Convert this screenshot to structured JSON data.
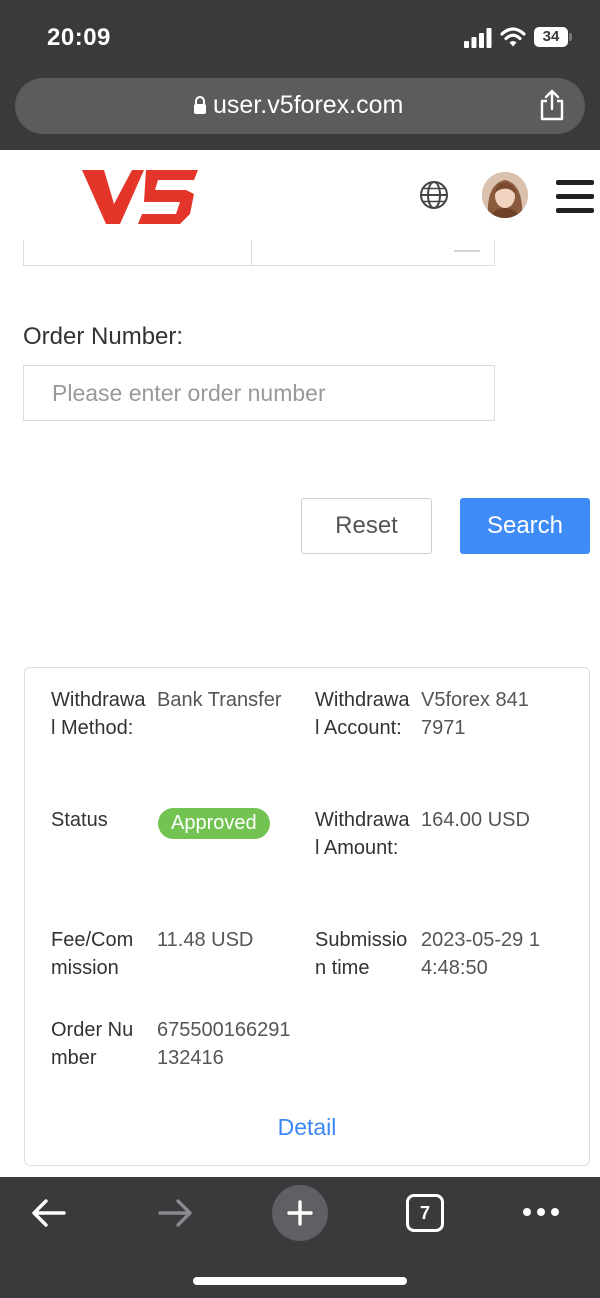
{
  "status_bar": {
    "time": "20:09",
    "battery": "34",
    "icons": [
      "signal-icon",
      "wifi-icon",
      "battery-icon"
    ]
  },
  "browser": {
    "url": "user.v5forex.com",
    "open_tabs": "7",
    "toolbar_icons": [
      "back-icon",
      "forward-icon",
      "plus-icon",
      "tabs-icon",
      "more-icon"
    ]
  },
  "header": {
    "logo_text": "V5",
    "brand_color": "#e3352a",
    "icons": [
      "globe-icon",
      "avatar",
      "menu-icon"
    ]
  },
  "form": {
    "order_label": "Order Number:",
    "order_placeholder": "Please enter order number",
    "order_value": "",
    "reset_label": "Reset",
    "search_label": "Search",
    "search_color": "#3f8cf8"
  },
  "record": {
    "withdrawal_method_label": "Withdrawal Method:",
    "withdrawal_method_value": "Bank Transfer",
    "withdrawal_account_label": "Withdrawal Account:",
    "withdrawal_account_value": "V5forex 8417971",
    "status_label": "Status",
    "status_value": "Approved",
    "status_color": "#72c351",
    "withdrawal_amount_label": "Withdrawal Amount:",
    "withdrawal_amount_value": "164.00 USD",
    "fee_label": "Fee/Commission",
    "fee_value": "11.48 USD",
    "submission_label": "Submission time",
    "submission_value": "2023-05-29 14:48:50",
    "order_number_label": "Order Number",
    "order_number_value": "675500166291132416",
    "detail_label": "Detail"
  }
}
